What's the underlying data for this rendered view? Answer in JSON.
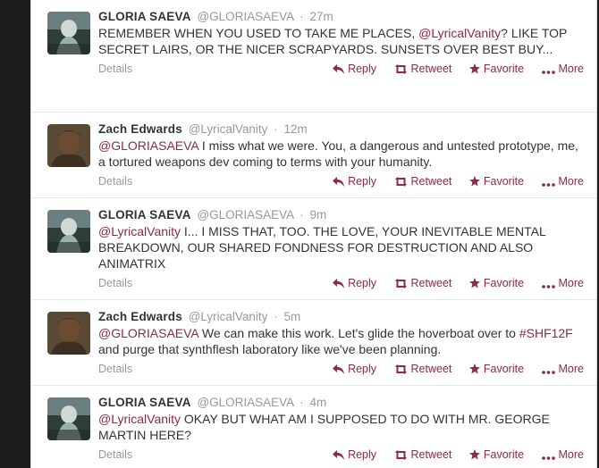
{
  "tweets": [
    {
      "name": "GLORIA SAEVA",
      "handle": "@GLORIASAEVA",
      "time": "27m",
      "mention": "",
      "text": "REMEMBER WHEN YOU USED TO TAKE ME PLACES, ",
      "mention_inline": "@LyricalVanity",
      "text_after": "? LIKE TOP SECRET LAIRS, OR THE NICER SCRAPYARDS. SUNSETS OVER BEST BUY..."
    },
    {
      "name": "Zach Edwards",
      "handle": "@LyricalVanity",
      "time": "12m",
      "mention": "@GLORIASAEVA",
      "text": " I miss what we were. You, a dangerous and untested prototype, me, a tortured weapons dev coming to terms with your humanity."
    },
    {
      "name": "GLORIA SAEVA",
      "handle": "@GLORIASAEVA",
      "time": "9m",
      "mention": "@LyricalVanity",
      "text": " I... I MISS THAT, TOO. THE LOVE, YOUR INEVITABLE MENTAL BREAKDOWN, OUR SHARED FONDNESS FOR DESTRUCTION AND ALSO ANIMATRIX"
    },
    {
      "name": "Zach Edwards",
      "handle": "@LyricalVanity",
      "time": "5m",
      "mention": "@GLORIASAEVA",
      "text": " We can make this work. Let's glide the hoverboat over to ",
      "hashtag": "#SHF12F",
      "text_after": " and purge that synthflesh laboratory like we've been planning."
    },
    {
      "name": "GLORIA SAEVA",
      "handle": "@GLORIASAEVA",
      "time": "4m",
      "mention": "@LyricalVanity",
      "text": " OKAY BUT WHAT AM I SUPPOSED TO DO WITH MR. GEORGE MARTIN HERE?"
    }
  ],
  "labels": {
    "details": "Details",
    "reply": "Reply",
    "retweet": "Retweet",
    "favorite": "Favorite",
    "more": "More",
    "dot": "·"
  },
  "colors": {
    "accent": "#8b2b3d",
    "name": "#333333",
    "muted": "#999999"
  }
}
